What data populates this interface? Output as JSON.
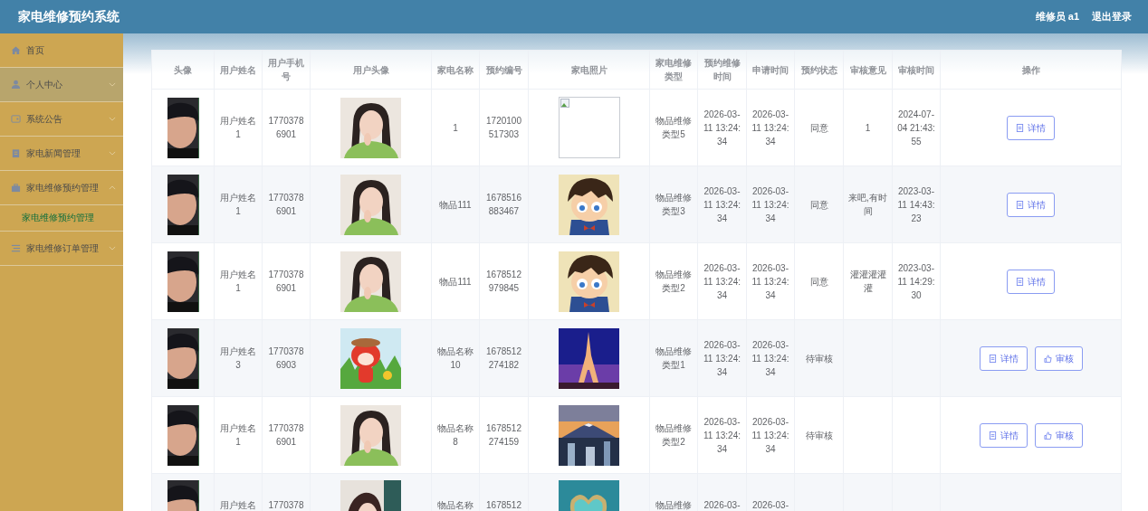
{
  "header": {
    "title": "家电维修预约系统",
    "user": "维修员 a1",
    "logout": "退出登录"
  },
  "sidebar": {
    "items": [
      {
        "label": "首页"
      },
      {
        "label": "个人中心",
        "expanded": false,
        "hovered": true
      },
      {
        "label": "系统公告",
        "expanded": false,
        "hovered": false
      },
      {
        "label": "家电新闻管理",
        "expanded": false,
        "hovered": false
      },
      {
        "label": "家电维修预约管理",
        "expanded": true,
        "hovered": false,
        "children": [
          {
            "label": "家电维修预约管理",
            "selected": true
          }
        ]
      },
      {
        "label": "家电维修订单管理",
        "expanded": false,
        "hovered": false
      }
    ]
  },
  "table": {
    "columns": [
      "头像",
      "用户姓名",
      "用户手机号",
      "用户头像",
      "家电名称",
      "预约编号",
      "家电照片",
      "家电维修类型",
      "预约维修时间",
      "申请时间",
      "预约状态",
      "审核意见",
      "审核时间",
      "操作"
    ],
    "rows": [
      {
        "user_name": "用户姓名1",
        "phone": "17703786901",
        "appliance": "1",
        "booking_no": "1720100517303",
        "photo": {
          "kind": "broken"
        },
        "repair_type": "物品维修类型5",
        "repair_time": "2026-03-11 13:24:34",
        "apply_time": "2026-03-11 13:24:34",
        "status": "同意",
        "opinion": "1",
        "review_time": "2024-07-04 21:43:55",
        "actions": [
          {
            "kind": "detail",
            "label": "详情"
          }
        ]
      },
      {
        "user_name": "用户姓名1",
        "phone": "17703786901",
        "appliance": "物品111",
        "booking_no": "1678516883467",
        "repair_type": "物品维修类型3",
        "repair_time": "2026-03-11 13:24:34",
        "apply_time": "2026-03-11 13:24:34",
        "status": "同意",
        "opinion": "来吧,有时间",
        "review_time": "2023-03-11 14:43:23",
        "actions": [
          {
            "kind": "detail",
            "label": "详情"
          }
        ]
      },
      {
        "user_name": "用户姓名1",
        "phone": "17703786901",
        "appliance": "物品111",
        "booking_no": "1678512979845",
        "repair_type": "物品维修类型2",
        "repair_time": "2026-03-11 13:24:34",
        "apply_time": "2026-03-11 13:24:34",
        "status": "同意",
        "opinion": "灌灌灌灌灌",
        "review_time": "2023-03-11 14:29:30",
        "actions": [
          {
            "kind": "detail",
            "label": "详情"
          }
        ]
      },
      {
        "user_name": "用户姓名3",
        "phone": "17703786903",
        "appliance": "物品名称10",
        "booking_no": "1678512274182",
        "repair_type": "物品维修类型1",
        "repair_time": "2026-03-11 13:24:34",
        "apply_time": "2026-03-11 13:24:34",
        "status": "待审核",
        "actions": [
          {
            "kind": "detail",
            "label": "详情"
          },
          {
            "kind": "review",
            "label": "审核"
          }
        ]
      },
      {
        "user_name": "用户姓名1",
        "phone": "17703786901",
        "appliance": "物品名称8",
        "booking_no": "1678512274159",
        "repair_type": "物品维修类型2",
        "repair_time": "2026-03-11 13:24:34",
        "apply_time": "2026-03-11 13:24:34",
        "status": "待审核",
        "actions": [
          {
            "kind": "detail",
            "label": "详情"
          },
          {
            "kind": "review",
            "label": "审核"
          }
        ]
      },
      {
        "user_name": "用户姓名",
        "phone": "1770378",
        "appliance": "物品名称",
        "booking_no": "1678512",
        "repair_type": "物品维修",
        "repair_time": "2026-03-",
        "apply_time": "2026-03-"
      }
    ]
  }
}
